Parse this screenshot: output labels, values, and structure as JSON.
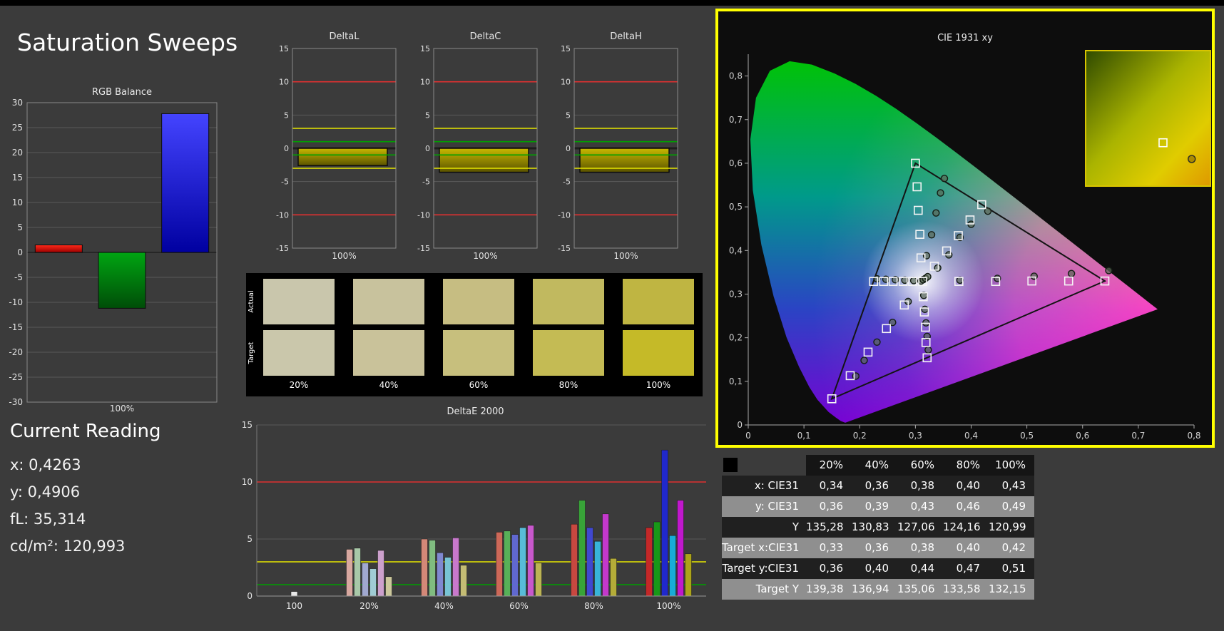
{
  "title": "Saturation Sweeps",
  "rgb_balance": {
    "title": "RGB Balance",
    "xlabel": "100%",
    "ylim": [
      -30,
      30
    ],
    "tick_step": 5,
    "bars": [
      {
        "name": "red",
        "value": 1.5,
        "color_top": "#ff2a1a",
        "color_bottom": "#9c0000"
      },
      {
        "name": "green",
        "value": -11.2,
        "color_top": "#00a512",
        "color_bottom": "#004d08"
      },
      {
        "name": "blue",
        "value": 27.8,
        "color_top": "#4444ff",
        "color_bottom": "#0000a0"
      }
    ]
  },
  "delta_charts": {
    "ylim": [
      -15,
      15
    ],
    "tick_step": 5,
    "xlabel": "100%",
    "ref_lines": [
      {
        "value": 10,
        "color": "#e03030"
      },
      {
        "value": -10,
        "color": "#e03030"
      },
      {
        "value": 3,
        "color": "#e8e800"
      },
      {
        "value": -3,
        "color": "#e8e800"
      },
      {
        "value": 1,
        "color": "#00a000"
      },
      {
        "value": -1,
        "color": "#00a000"
      }
    ],
    "bar_color_top": "#c8b800",
    "bar_color_bottom": "#5a5200",
    "charts": [
      {
        "title": "DeltaL",
        "value": -2.6
      },
      {
        "title": "DeltaC",
        "value": -3.6
      },
      {
        "title": "DeltaH",
        "value": -3.6
      }
    ]
  },
  "swatches": {
    "labels": [
      "20%",
      "40%",
      "60%",
      "80%",
      "100%"
    ],
    "rows": [
      {
        "label": "Actual",
        "colors": [
          "#c9c6ac",
          "#c8c29d",
          "#c6bd82",
          "#c1b95f",
          "#bfb542"
        ]
      },
      {
        "label": "Target",
        "colors": [
          "#cac7ab",
          "#c9c29a",
          "#c7bf7d",
          "#c4bb54",
          "#c5ba28"
        ]
      }
    ]
  },
  "deltae2000": {
    "title": "DeltaE 2000",
    "ylim": [
      0,
      15
    ],
    "yticks": [
      0,
      5,
      10,
      15
    ],
    "ref_lines": [
      {
        "value": 10,
        "color": "#e03030"
      },
      {
        "value": 3,
        "color": "#e8e800"
      },
      {
        "value": 1,
        "color": "#00a000"
      }
    ],
    "groups": [
      {
        "label": "100",
        "values": [
          0.4
        ],
        "colors": [
          "#e8e8e8"
        ]
      },
      {
        "label": "20%",
        "values": [
          4.1,
          4.2,
          2.9,
          2.4,
          4.0,
          1.7
        ],
        "colors": [
          "#d8a8a0",
          "#a8c8a8",
          "#a0a8d0",
          "#a0ccd4",
          "#cca0cc",
          "#ccc89c"
        ]
      },
      {
        "label": "40%",
        "values": [
          5.0,
          4.9,
          3.8,
          3.4,
          5.1,
          2.7
        ],
        "colors": [
          "#d48878",
          "#80bc80",
          "#8088d0",
          "#78c4d4",
          "#c878cc",
          "#c4bc74"
        ]
      },
      {
        "label": "60%",
        "values": [
          5.6,
          5.7,
          5.4,
          6.0,
          6.2,
          2.9
        ],
        "colors": [
          "#cc6858",
          "#58b058",
          "#6068d0",
          "#58bcd8",
          "#c858cc",
          "#bcb454"
        ]
      },
      {
        "label": "80%",
        "values": [
          6.3,
          8.4,
          6.0,
          4.8,
          7.2,
          3.3
        ],
        "colors": [
          "#c84840",
          "#38a438",
          "#4048d0",
          "#38b4d8",
          "#c438cc",
          "#b4ac38"
        ]
      },
      {
        "label": "100%",
        "values": [
          6.0,
          6.5,
          12.8,
          5.3,
          8.4,
          3.7
        ],
        "colors": [
          "#c42828",
          "#189818",
          "#2028cc",
          "#18acd8",
          "#c018cc",
          "#aca418"
        ]
      }
    ]
  },
  "cie": {
    "title": "CIE 1931 xy",
    "xlim": [
      0,
      0.8
    ],
    "ylim": [
      0,
      0.85
    ],
    "xticks": [
      "0",
      "0,1",
      "0,2",
      "0,3",
      "0,4",
      "0,5",
      "0,6",
      "0,7",
      "0,8"
    ],
    "yticks": [
      "0",
      "0,1",
      "0,2",
      "0,3",
      "0,4",
      "0,5",
      "0,6",
      "0,7",
      "0,8"
    ],
    "triangle": [
      [
        0.64,
        0.33
      ],
      [
        0.3,
        0.6
      ],
      [
        0.15,
        0.06
      ]
    ],
    "targets": {
      "white": [
        [
          0.313,
          0.329
        ]
      ],
      "red": [
        [
          0.378,
          0.329
        ],
        [
          0.444,
          0.329
        ],
        [
          0.509,
          0.33
        ],
        [
          0.575,
          0.33
        ],
        [
          0.64,
          0.33
        ]
      ],
      "green": [
        [
          0.31,
          0.383
        ],
        [
          0.308,
          0.437
        ],
        [
          0.305,
          0.492
        ],
        [
          0.303,
          0.546
        ],
        [
          0.3,
          0.6
        ]
      ],
      "blue": [
        [
          0.28,
          0.275
        ],
        [
          0.248,
          0.221
        ],
        [
          0.215,
          0.167
        ],
        [
          0.183,
          0.113
        ],
        [
          0.15,
          0.06
        ]
      ],
      "cyan": [
        [
          0.295,
          0.329
        ],
        [
          0.278,
          0.329
        ],
        [
          0.26,
          0.329
        ],
        [
          0.243,
          0.329
        ],
        [
          0.225,
          0.329
        ]
      ],
      "magenta": [
        [
          0.314,
          0.294
        ],
        [
          0.316,
          0.259
        ],
        [
          0.318,
          0.224
        ],
        [
          0.319,
          0.189
        ],
        [
          0.321,
          0.154
        ]
      ],
      "yellow": [
        [
          0.334,
          0.364
        ],
        [
          0.356,
          0.399
        ],
        [
          0.377,
          0.434
        ],
        [
          0.398,
          0.47
        ],
        [
          0.419,
          0.505
        ]
      ]
    },
    "measurements": {
      "white": [
        [
          0.31,
          0.33
        ],
        [
          0.314,
          0.333
        ],
        [
          0.318,
          0.336
        ],
        [
          0.322,
          0.34
        ]
      ],
      "red": [
        [
          0.38,
          0.332
        ],
        [
          0.447,
          0.336
        ],
        [
          0.513,
          0.341
        ],
        [
          0.58,
          0.347
        ],
        [
          0.647,
          0.354
        ]
      ],
      "green": [
        [
          0.32,
          0.388
        ],
        [
          0.329,
          0.436
        ],
        [
          0.337,
          0.486
        ],
        [
          0.345,
          0.532
        ],
        [
          0.352,
          0.565
        ]
      ],
      "blue": [
        [
          0.287,
          0.283
        ],
        [
          0.259,
          0.235
        ],
        [
          0.231,
          0.19
        ],
        [
          0.208,
          0.148
        ],
        [
          0.193,
          0.112
        ]
      ],
      "cyan": [
        [
          0.297,
          0.331
        ],
        [
          0.281,
          0.332
        ],
        [
          0.264,
          0.333
        ],
        [
          0.247,
          0.334
        ],
        [
          0.231,
          0.335
        ]
      ],
      "magenta": [
        [
          0.315,
          0.297
        ],
        [
          0.317,
          0.265
        ],
        [
          0.319,
          0.234
        ],
        [
          0.321,
          0.203
        ],
        [
          0.323,
          0.172
        ]
      ],
      "yellow": [
        [
          0.34,
          0.36
        ],
        [
          0.36,
          0.39
        ],
        [
          0.38,
          0.43
        ],
        [
          0.4,
          0.46
        ],
        [
          0.43,
          0.49
        ]
      ]
    },
    "inset": {
      "square": [
        0.62,
        0.68
      ],
      "circle": [
        0.85,
        0.8
      ]
    }
  },
  "current_reading": {
    "heading": "Current Reading",
    "lines": [
      "x: 0,4263",
      "y: 0,4906",
      "fL: 35,314",
      "cd/m²: 120,993"
    ]
  },
  "table": {
    "columns": [
      "20%",
      "40%",
      "60%",
      "80%",
      "100%"
    ],
    "rows": [
      {
        "label": "x: CIE31",
        "values": [
          "0,34",
          "0,36",
          "0,38",
          "0,40",
          "0,43"
        ]
      },
      {
        "label": "y: CIE31",
        "values": [
          "0,36",
          "0,39",
          "0,43",
          "0,46",
          "0,49"
        ]
      },
      {
        "label": "Y",
        "values": [
          "135,28",
          "130,83",
          "127,06",
          "124,16",
          "120,99"
        ]
      },
      {
        "label": "Target x:CIE31",
        "values": [
          "0,33",
          "0,36",
          "0,38",
          "0,40",
          "0,42"
        ]
      },
      {
        "label": "Target y:CIE31",
        "values": [
          "0,36",
          "0,40",
          "0,44",
          "0,47",
          "0,51"
        ]
      },
      {
        "label": "Target Y",
        "values": [
          "139,38",
          "136,94",
          "135,06",
          "133,58",
          "132,15"
        ]
      }
    ]
  }
}
